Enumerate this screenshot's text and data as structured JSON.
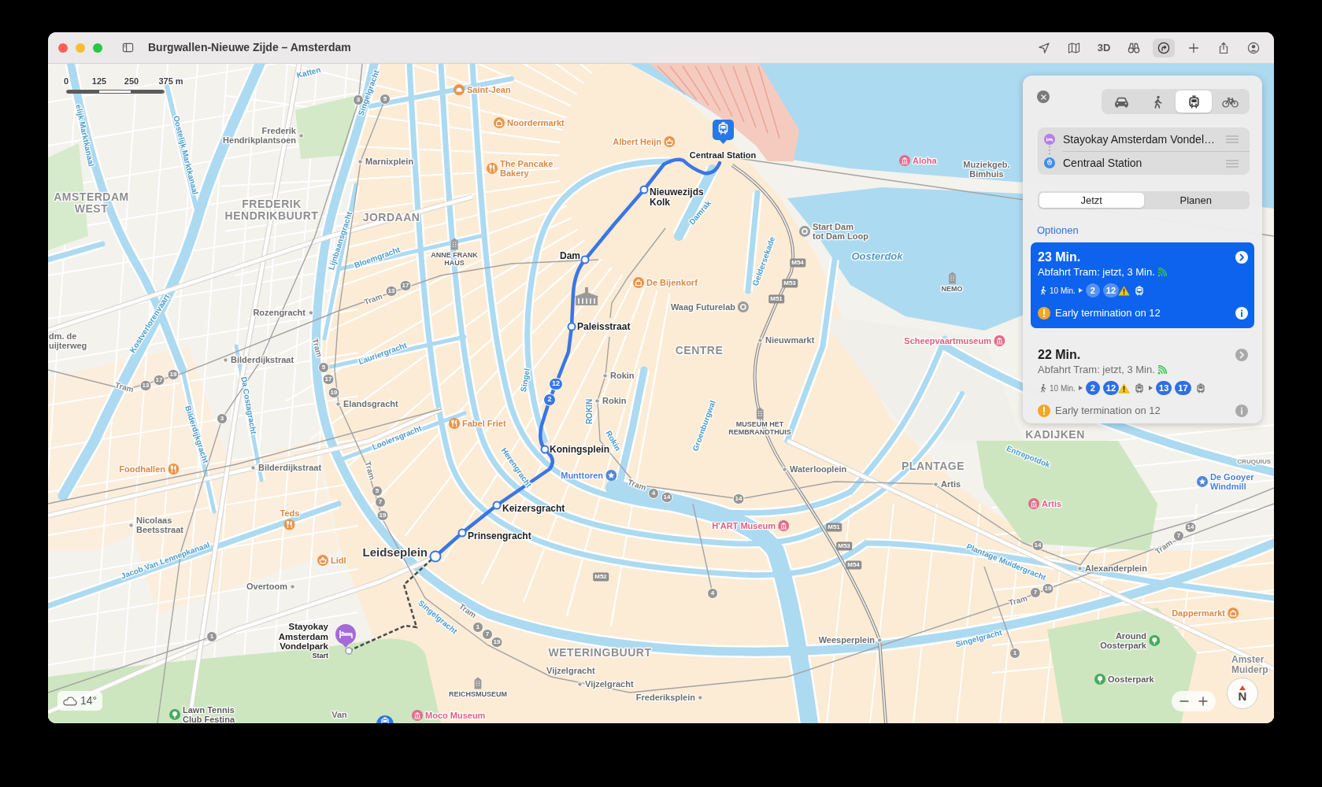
{
  "window": {
    "title": "Burgwallen-Nieuwe Zijde – Amsterdam"
  },
  "toolbar": {
    "label_3d": "3D",
    "directions_active": true
  },
  "map": {
    "scale": [
      "0",
      "125",
      "250",
      "375 m"
    ],
    "labels": [
      {
        "kind": "canal",
        "lines": [
          "Katten"
        ]
      },
      {
        "kind": "canal",
        "lines": [
          "elijk Marktkanaal"
        ]
      },
      {
        "kind": "canal",
        "lines": [
          "Oostelijk Marktkanaal"
        ]
      },
      {
        "kind": "canal",
        "lines": [
          "Singelgracht"
        ]
      },
      {
        "kind": "line",
        "lines": [
          "3"
        ]
      },
      {
        "kind": "line",
        "lines": [
          "5"
        ]
      },
      {
        "kind": "stop",
        "lines": [
          "Frederik",
          "Hendrikplantsoen"
        ]
      },
      {
        "kind": "stop",
        "lines": [
          "Marnixplein"
        ]
      },
      {
        "kind": "bakery",
        "lines": [
          "Saint-Jean"
        ]
      },
      {
        "kind": "shop",
        "lines": [
          "Noordermarkt"
        ]
      },
      {
        "kind": "restaurant",
        "lines": [
          "The Pancake",
          "Bakery"
        ]
      },
      {
        "kind": "grocery",
        "lines": [
          "Albert Heijn"
        ]
      },
      {
        "kind": "area",
        "lines": [
          "AMSTERDAM",
          "WEST"
        ]
      },
      {
        "kind": "area",
        "lines": [
          "FREDERIK",
          "HENDRIKBUURT"
        ]
      },
      {
        "kind": "area",
        "lines": [
          "JORDAAN"
        ]
      },
      {
        "kind": "landmark",
        "lines": [
          "ANNE FRANK",
          "HAUS"
        ]
      },
      {
        "kind": "canal",
        "lines": [
          "Bloemgracht"
        ]
      },
      {
        "kind": "canal",
        "lines": [
          "Lijnbaansgracht"
        ]
      },
      {
        "kind": "canal",
        "lines": [
          "Kostverlorenvaart"
        ]
      },
      {
        "kind": "stop",
        "lines": [
          "Rozengracht"
        ]
      },
      {
        "kind": "tram",
        "lines": [
          "Tram"
        ]
      },
      {
        "kind": "line",
        "lines": [
          "13"
        ]
      },
      {
        "kind": "line",
        "lines": [
          "17"
        ]
      },
      {
        "kind": "place",
        "lines": [
          "dm. de",
          "uijterweg"
        ]
      },
      {
        "kind": "stop",
        "lines": [
          "Bilderdijkstraat"
        ]
      },
      {
        "kind": "canal",
        "lines": [
          "Lauriergracht"
        ]
      },
      {
        "kind": "tram",
        "lines": [
          "Tram"
        ]
      },
      {
        "kind": "line",
        "lines": [
          "13"
        ]
      },
      {
        "kind": "line",
        "lines": [
          "17"
        ]
      },
      {
        "kind": "line",
        "lines": [
          "19"
        ]
      },
      {
        "kind": "canal",
        "lines": [
          "Da Costagracht"
        ]
      },
      {
        "kind": "tram",
        "lines": [
          "Tram"
        ]
      },
      {
        "kind": "line",
        "lines": [
          "5"
        ]
      },
      {
        "kind": "line",
        "lines": [
          "17"
        ]
      },
      {
        "kind": "line",
        "lines": [
          "19"
        ]
      },
      {
        "kind": "stop",
        "lines": [
          "Elandsgracht"
        ]
      },
      {
        "kind": "canal",
        "lines": [
          "Bilderdijkgracht"
        ]
      },
      {
        "kind": "line",
        "lines": [
          "3"
        ]
      },
      {
        "kind": "canal",
        "lines": [
          "Looiersgracht"
        ]
      },
      {
        "kind": "restaurant",
        "lines": [
          "Fabel Friet"
        ]
      },
      {
        "kind": "tram",
        "lines": [
          "Tram"
        ]
      },
      {
        "kind": "line",
        "lines": [
          "5"
        ]
      },
      {
        "kind": "line",
        "lines": [
          "7"
        ]
      },
      {
        "kind": "line",
        "lines": [
          "19"
        ]
      },
      {
        "kind": "restaurant",
        "lines": [
          "Foodhallen"
        ]
      },
      {
        "kind": "stop",
        "lines": [
          "Bilderdijkstraat"
        ]
      },
      {
        "kind": "restaurant",
        "lines": [
          "Teds"
        ]
      },
      {
        "kind": "stop",
        "lines": [
          "Nicolaas",
          "Beetsstraat"
        ]
      },
      {
        "kind": "canal",
        "lines": [
          "Jacob Van Lennepkanaal"
        ]
      },
      {
        "kind": "grocery",
        "lines": [
          "Lidl"
        ]
      },
      {
        "kind": "stop",
        "lines": [
          "Overtoom"
        ]
      },
      {
        "kind": "line",
        "lines": [
          "1"
        ]
      },
      {
        "kind": "hub",
        "lines": [
          "Leidseplein"
        ]
      },
      {
        "kind": "route_stop",
        "lines": [
          "Prinsengracht"
        ]
      },
      {
        "kind": "route_stop",
        "lines": [
          "Keizersgracht"
        ]
      },
      {
        "kind": "canal",
        "lines": [
          "Herengracht"
        ]
      },
      {
        "kind": "route_stop",
        "lines": [
          "Koningsplein"
        ]
      },
      {
        "kind": "sight",
        "lines": [
          "Munttoren"
        ]
      },
      {
        "kind": "canal",
        "lines": [
          "Singel"
        ]
      },
      {
        "kind": "route_line",
        "lines": [
          "12"
        ]
      },
      {
        "kind": "route_line",
        "lines": [
          "2"
        ]
      },
      {
        "kind": "route_stop",
        "lines": [
          "Paleisstraat"
        ]
      },
      {
        "kind": "route_stop",
        "lines": [
          "Dam"
        ]
      },
      {
        "kind": "route_stop",
        "lines": [
          "Nieuwezijds",
          "Kolk"
        ]
      },
      {
        "kind": "station",
        "lines": [
          "Centraal Station"
        ]
      },
      {
        "kind": "canal",
        "lines": [
          "Damrak"
        ]
      },
      {
        "kind": "shop",
        "lines": [
          "De Bijenkorf"
        ]
      },
      {
        "kind": "venue",
        "lines": [
          "Waag Futurelab"
        ]
      },
      {
        "kind": "canal",
        "lines": [
          "ROKIN"
        ]
      },
      {
        "kind": "stop",
        "lines": [
          "Rokin"
        ]
      },
      {
        "kind": "stop",
        "lines": [
          "Rokin"
        ]
      },
      {
        "kind": "canal",
        "lines": [
          "Rokin"
        ]
      },
      {
        "kind": "area",
        "lines": [
          "CENTRE"
        ]
      },
      {
        "kind": "canal",
        "lines": [
          "Geldersekade"
        ]
      },
      {
        "kind": "venue",
        "lines": [
          "Start Dam",
          "tot Dam Loop"
        ]
      },
      {
        "kind": "water",
        "lines": [
          "Oosterdok"
        ]
      },
      {
        "kind": "metro",
        "lines": [
          "M54"
        ]
      },
      {
        "kind": "metro",
        "lines": [
          "M53"
        ]
      },
      {
        "kind": "metro",
        "lines": [
          "M51"
        ]
      },
      {
        "kind": "landmark",
        "lines": [
          "NEMO"
        ]
      },
      {
        "kind": "stop",
        "lines": [
          "Nieuwmarkt"
        ]
      },
      {
        "kind": "museum",
        "lines": [
          "Scheepvaartmuseum"
        ]
      },
      {
        "kind": "museum",
        "lines": [
          "Aloha"
        ]
      },
      {
        "kind": "place",
        "lines": [
          "Muziekgeb.",
          "Bimhuis"
        ]
      },
      {
        "kind": "canal",
        "lines": [
          "Groenburgwal"
        ]
      },
      {
        "kind": "landmark",
        "lines": [
          "MUSEUM HET",
          "REMBRANDTHUIS"
        ]
      },
      {
        "kind": "stop",
        "lines": [
          "Waterlooplein"
        ]
      },
      {
        "kind": "area",
        "lines": [
          "KADIJKEN"
        ]
      },
      {
        "kind": "canal",
        "lines": [
          "Entrepotdok"
        ]
      },
      {
        "kind": "locality",
        "lines": [
          "CRUQUIUS"
        ]
      },
      {
        "kind": "area",
        "lines": [
          "PLANTAGE"
        ]
      },
      {
        "kind": "stop",
        "lines": [
          "Artis"
        ]
      },
      {
        "kind": "museum",
        "lines": [
          "Artis"
        ]
      },
      {
        "kind": "sight",
        "lines": [
          "De Gooyer",
          "Windmill"
        ]
      },
      {
        "kind": "tram",
        "lines": [
          "Tram"
        ]
      },
      {
        "kind": "line",
        "lines": [
          "4"
        ]
      },
      {
        "kind": "line",
        "lines": [
          "14"
        ]
      },
      {
        "kind": "line",
        "lines": [
          "14"
        ]
      },
      {
        "kind": "museum",
        "lines": [
          "H'ART Museum"
        ]
      },
      {
        "kind": "metro",
        "lines": [
          "M51"
        ]
      },
      {
        "kind": "metro",
        "lines": [
          "M53"
        ]
      },
      {
        "kind": "metro",
        "lines": [
          "M54"
        ]
      },
      {
        "kind": "metro",
        "lines": [
          "M52"
        ]
      },
      {
        "kind": "line",
        "lines": [
          "4"
        ]
      },
      {
        "kind": "line",
        "lines": [
          "14"
        ]
      },
      {
        "kind": "canal",
        "lines": [
          "Plantage Muidergracht"
        ]
      },
      {
        "kind": "stop",
        "lines": [
          "Alexanderplein"
        ]
      },
      {
        "kind": "tram",
        "lines": [
          "Tram"
        ]
      },
      {
        "kind": "line",
        "lines": [
          "7"
        ]
      },
      {
        "kind": "line",
        "lines": [
          "14"
        ]
      },
      {
        "kind": "tram",
        "lines": [
          "Tram"
        ]
      },
      {
        "kind": "line",
        "lines": [
          "7"
        ]
      },
      {
        "kind": "line",
        "lines": [
          "19"
        ]
      },
      {
        "kind": "area",
        "lines": [
          "WETERINGBUURT"
        ]
      },
      {
        "kind": "stop",
        "lines": [
          "Weesperplein"
        ]
      },
      {
        "kind": "canal",
        "lines": [
          "Singelgracht"
        ]
      },
      {
        "kind": "line",
        "lines": [
          "1"
        ]
      },
      {
        "kind": "shop",
        "lines": [
          "Dappermarkt"
        ]
      },
      {
        "kind": "park",
        "lines": [
          "Around",
          "Oosterpark"
        ]
      },
      {
        "kind": "park",
        "lines": [
          "Oosterpark"
        ]
      },
      {
        "kind": "place",
        "lines": [
          "Vijzelgracht"
        ]
      },
      {
        "kind": "stop",
        "lines": [
          "Vijzelgracht"
        ]
      },
      {
        "kind": "district",
        "lines": [
          "Amster",
          "Muiderp"
        ]
      },
      {
        "kind": "stop",
        "lines": [
          "Frederiksplein"
        ]
      },
      {
        "kind": "canal",
        "lines": [
          "Singelgracht"
        ]
      },
      {
        "kind": "tram",
        "lines": [
          "Tram"
        ]
      },
      {
        "kind": "line",
        "lines": [
          "1"
        ]
      },
      {
        "kind": "line",
        "lines": [
          "7"
        ]
      },
      {
        "kind": "line",
        "lines": [
          "19"
        ]
      },
      {
        "kind": "landmark",
        "lines": [
          "REICHSMUSEUM"
        ]
      },
      {
        "kind": "park",
        "lines": [
          "Lawn Tennis",
          "Club Festina"
        ]
      },
      {
        "kind": "place",
        "lines": [
          "Van"
        ]
      },
      {
        "kind": "museum",
        "lines": [
          "Moco Museum"
        ]
      }
    ],
    "start": {
      "lines": [
        "Stayokay",
        "Amsterdam",
        "Vondelpark"
      ],
      "caption": "Start"
    },
    "weather": {
      "temperature": "14°"
    },
    "compass": "N"
  },
  "directions": {
    "modes": [
      {
        "kind": "car",
        "selected": false
      },
      {
        "kind": "walk",
        "selected": false
      },
      {
        "kind": "transit",
        "selected": true
      },
      {
        "kind": "bike",
        "selected": false
      }
    ],
    "waypoints": [
      {
        "kind": "hotel",
        "name": "Stayokay Amsterdam Vondel…"
      },
      {
        "kind": "transit",
        "name": "Centraal Station"
      }
    ],
    "time_options": [
      {
        "label": "Jetzt",
        "selected": true
      },
      {
        "label": "Planen",
        "selected": false
      }
    ],
    "options_heading": "Optionen",
    "routes": [
      {
        "selected": true,
        "duration": "23 Min.",
        "departure": "Abfahrt Tram: jetzt, 3 Min.",
        "legs": [
          {
            "kind": "walk",
            "duration": "10 Min."
          },
          {
            "kind": "transit",
            "lines": [
              {
                "number": "2",
                "warning": false
              },
              {
                "number": "12",
                "warning": true
              }
            ]
          }
        ],
        "notice": "Early termination on 12"
      },
      {
        "selected": false,
        "duration": "22 Min.",
        "departure": "Abfahrt Tram: jetzt, 3 Min.",
        "legs": [
          {
            "kind": "walk",
            "duration": "10 Min."
          },
          {
            "kind": "transit",
            "lines": [
              {
                "number": "2",
                "warning": false
              },
              {
                "number": "12",
                "warning": true
              }
            ]
          },
          {
            "kind": "transit",
            "lines": [
              {
                "number": "13",
                "warning": false
              },
              {
                "number": "17",
                "warning": false
              }
            ]
          }
        ],
        "notice": "Early termination on 12"
      }
    ]
  }
}
